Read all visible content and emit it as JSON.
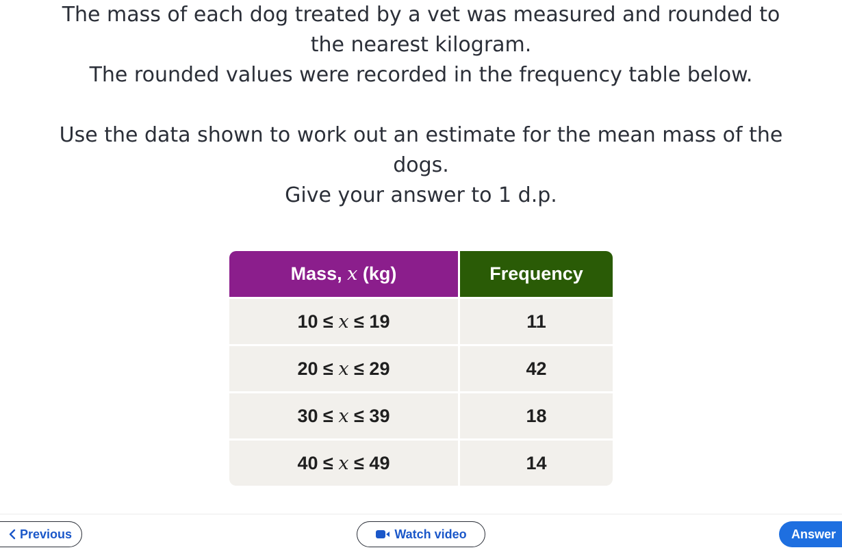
{
  "question": {
    "lines_para1": [
      "The mass of each dog treated by a vet was measured and rounded to",
      "the nearest kilogram.",
      "The rounded values were recorded in the frequency table below."
    ],
    "lines_para2": [
      "Use the data shown to work out an estimate for the mean mass of the",
      "dogs.",
      "Give your answer to 1 d.p."
    ]
  },
  "table": {
    "header_mass_prefix": "Mass, ",
    "header_mass_var": "x",
    "header_mass_suffix": " (kg)",
    "header_frequency": "Frequency",
    "rows": [
      {
        "low": "10 ≤ ",
        "var": "x",
        "high": " ≤ 19",
        "frequency": "11"
      },
      {
        "low": "20 ≤ ",
        "var": "x",
        "high": " ≤ 29",
        "frequency": "42"
      },
      {
        "low": "30 ≤ ",
        "var": "x",
        "high": " ≤ 39",
        "frequency": "18"
      },
      {
        "low": "40 ≤ ",
        "var": "x",
        "high": " ≤ 49",
        "frequency": "14"
      }
    ],
    "colors": {
      "mass_header": "#8b1e8c",
      "frequency_header": "#2a5b06",
      "row_background": "#f2f0ec"
    }
  },
  "footer": {
    "previous_label": "Previous",
    "previous_icon": "chevron-left-icon",
    "watch_video_label": "Watch video",
    "watch_video_icon": "video-camera-icon",
    "answer_label": "Answer",
    "link_color": "#1a57c9",
    "answer_color": "#1e6fe0"
  }
}
